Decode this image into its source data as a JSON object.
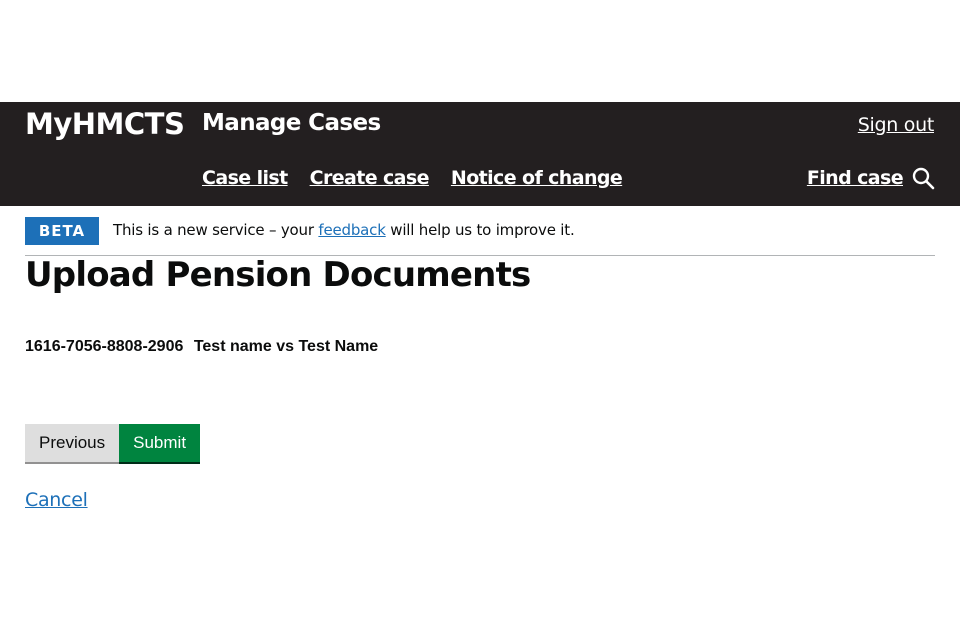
{
  "header": {
    "brand": "MyHMCTS",
    "service_name": "Manage Cases",
    "sign_out": "Sign out",
    "nav": [
      {
        "label": "Case list"
      },
      {
        "label": "Create case"
      },
      {
        "label": "Notice of change"
      }
    ],
    "find_case": "Find case",
    "search_icon": "search-icon",
    "background_color": "#231f20"
  },
  "phase_banner": {
    "tag": "BETA",
    "text_before": "This is a new service – your",
    "link": "feedback",
    "text_after": "will help us to improve it.",
    "tag_color": "#1d70b8"
  },
  "page": {
    "title": "Upload Pension Documents",
    "case_number": "1616-7056-8808-2906",
    "case_name": "Test name vs Test Name"
  },
  "actions": {
    "previous": "Previous",
    "submit": "Submit",
    "cancel": "Cancel",
    "submit_color": "#00843f"
  }
}
